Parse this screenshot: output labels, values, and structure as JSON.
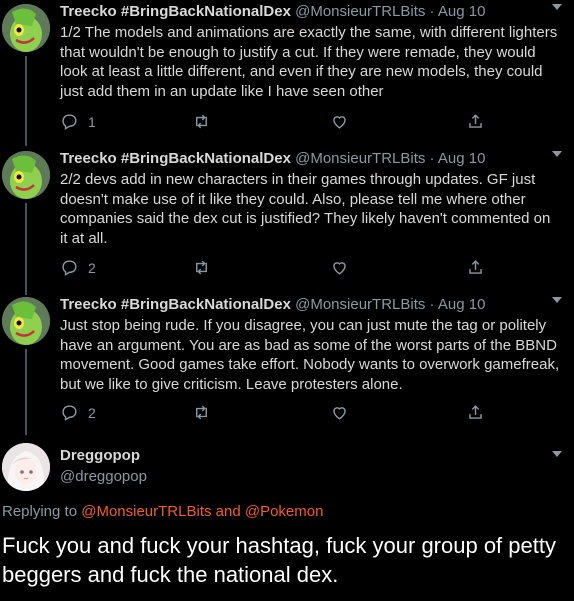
{
  "tweets": [
    {
      "name": "Treecko #BringBackNationalDex",
      "handle": "@MonsieurTRLBits",
      "sep": "·",
      "date": "Aug 10",
      "text": "1/2 The models and animations are exactly the same, with different lighters that wouldn't be enough to justify a cut. If they were remade, they would look at least a little different, and even if they are new models, they could just add them in an update like I have seen other",
      "replies": "1"
    },
    {
      "name": "Treecko #BringBackNationalDex",
      "handle": "@MonsieurTRLBits",
      "sep": "·",
      "date": "Aug 10",
      "text": "2/2 devs add in new characters in their games through updates. GF just doesn't make use of it like they could. Also, please tell me where other companies said the dex cut is justified? They likely haven't commented on it at all.",
      "replies": "2"
    },
    {
      "name": "Treecko #BringBackNationalDex",
      "handle": "@MonsieurTRLBits",
      "sep": "·",
      "date": "Aug 10",
      "text": "Just stop being rude. If you disagree, you can just mute the tag or politely have an argument. You are as bad as some of the worst parts of the BBND movement. Good games take effort. Nobody wants to overwork gamefreak, but we like to give criticism. Leave protesters alone.",
      "replies": "2"
    }
  ],
  "focal": {
    "name": "Dreggopop",
    "handle": "@dreggopop",
    "replying_prefix": "Replying to",
    "mention_1": "@MonsieurTRLBits",
    "and_word": "and",
    "mention_2": "@Pokemon",
    "text": "Fuck you and fuck your hashtag, fuck your group of petty beggers and fuck the national dex."
  },
  "colors": {
    "background": "#000000",
    "accent": "#f45d22",
    "muted": "#8899a6"
  },
  "icons": [
    "reply-icon",
    "retweet-icon",
    "like-icon",
    "share-icon",
    "chevron-down-icon"
  ]
}
